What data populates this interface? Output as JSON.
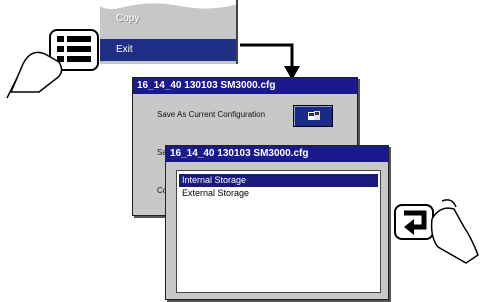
{
  "menu": {
    "copy_label": "Copy",
    "exit_label": "Exit"
  },
  "dialog_save": {
    "title": "16_14_40 130103 SM3000.cfg",
    "row1_label": "Save As Current Configuration",
    "row2_label": "Sa",
    "row3_label": "Co"
  },
  "dialog_storage": {
    "title": "16_14_40 130103 SM3000.cfg",
    "options": [
      "Internal Storage",
      "External Storage"
    ]
  },
  "colors": {
    "titlebar": "#1a1a8c",
    "selection": "#1a1a7c",
    "window": "#c8c8c8"
  }
}
